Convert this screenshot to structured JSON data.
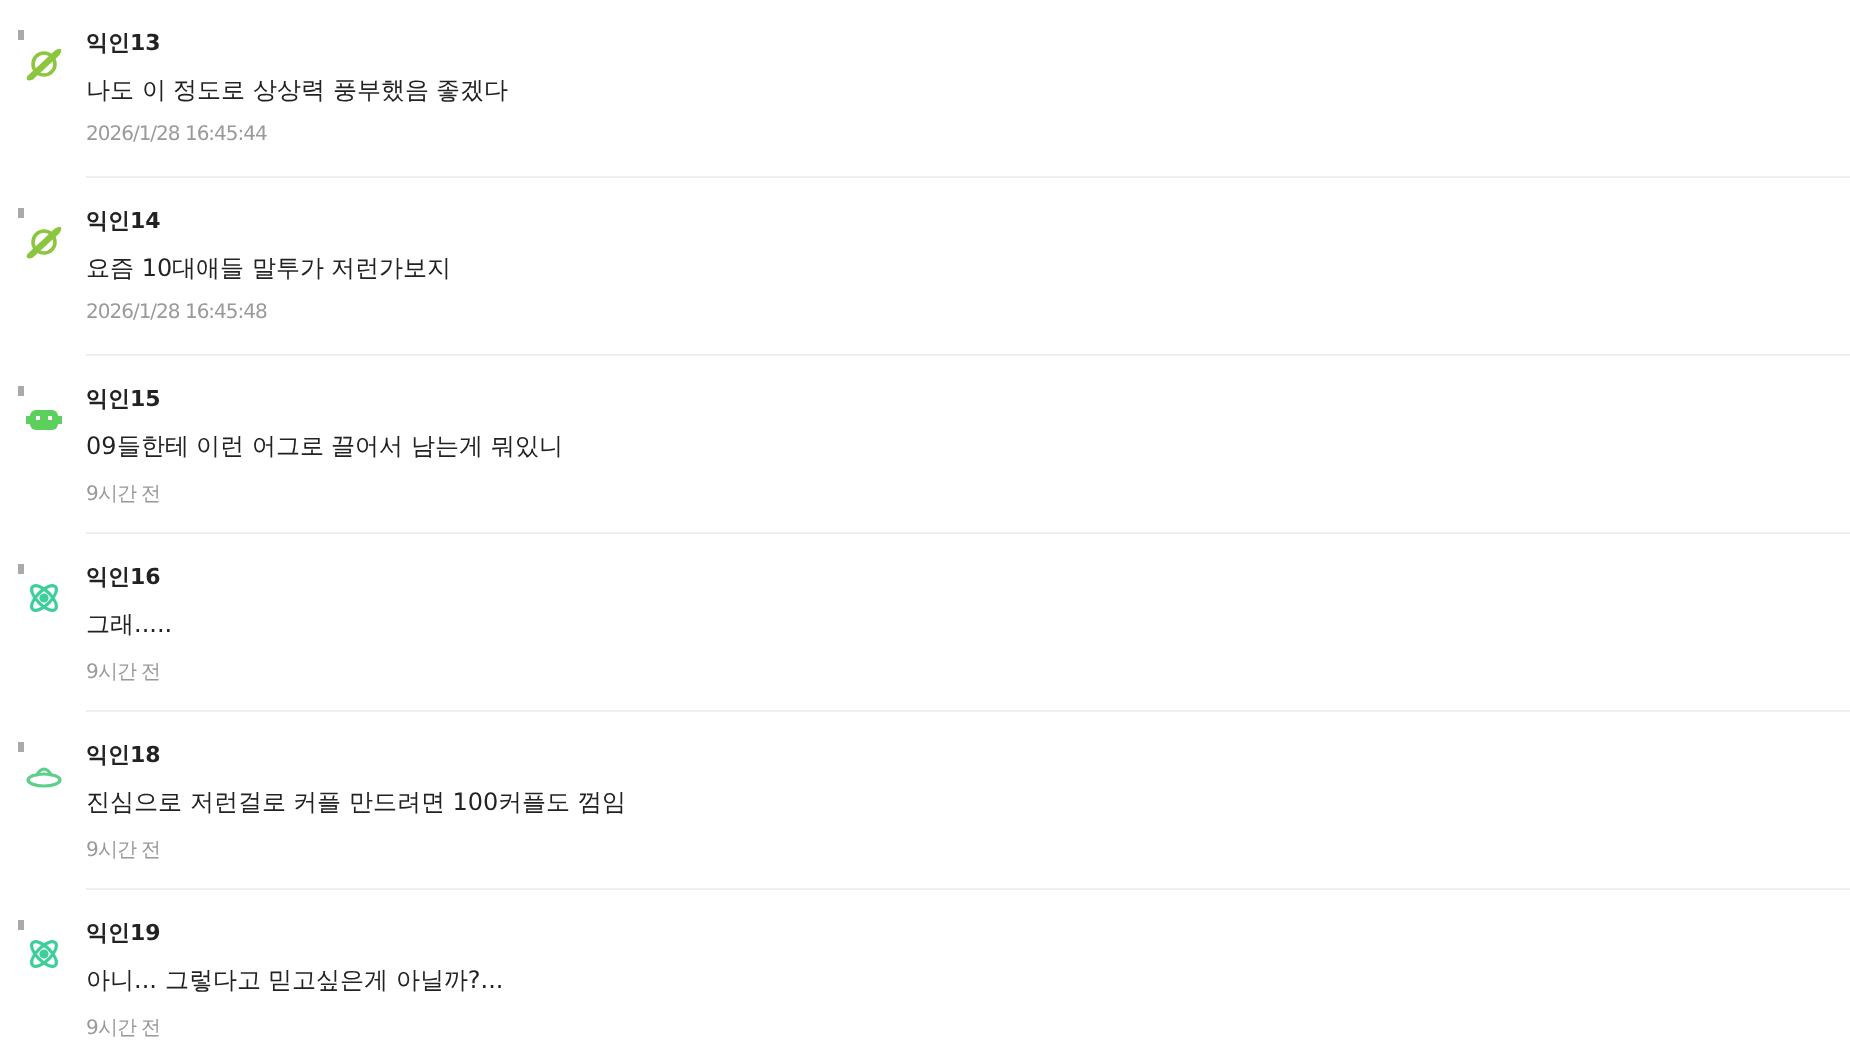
{
  "comments": [
    {
      "author": "익인13",
      "kind": "planet",
      "color": "#8cc63f",
      "text": "나도 이 정도로 상상력 풍부했음 좋겠다",
      "time": "2026/1/28 16:45:44"
    },
    {
      "author": "익인14",
      "kind": "planet",
      "color": "#8cc63f",
      "text": "요즘 10대애들 말투가 저런가보지",
      "time": "2026/1/28 16:45:48"
    },
    {
      "author": "익인15",
      "kind": "robot",
      "color": "#5ccf5c",
      "text": "09들한테 이런 어그로 끌어서 남는게 뭐있니",
      "time": "9시간 전"
    },
    {
      "author": "익인16",
      "kind": "atom",
      "color": "#3ccf9a",
      "text": "그래.....",
      "time": "9시간 전"
    },
    {
      "author": "익인18",
      "kind": "ufo",
      "color": "#5ccf8a",
      "text": "진심으로 저런걸로 커플 만드려면 100커플도 껌임",
      "time": "9시간 전"
    },
    {
      "author": "익인19",
      "kind": "atom",
      "color": "#3ccf9a",
      "text": "아니... 그렇다고 믿고싶은게 아닐까?...",
      "time": "9시간 전"
    }
  ]
}
